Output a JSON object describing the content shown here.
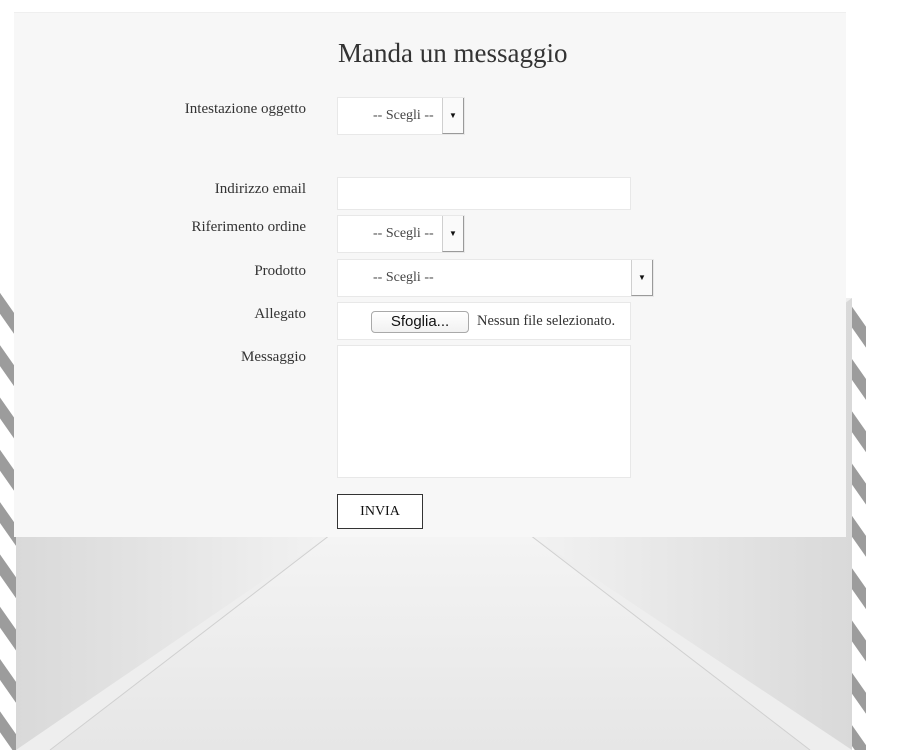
{
  "form": {
    "title": "Manda un messaggio",
    "subject": {
      "label": "Intestazione oggetto",
      "value": "-- Scegli --"
    },
    "email": {
      "label": "Indirizzo email",
      "value": ""
    },
    "order_ref": {
      "label": "Riferimento ordine",
      "value": "-- Scegli --"
    },
    "product": {
      "label": "Prodotto",
      "value": "-- Scegli --"
    },
    "attachment": {
      "label": "Allegato",
      "button_label": "Sfoglia...",
      "status": "Nessun file selezionato."
    },
    "message": {
      "label": "Messaggio",
      "value": ""
    },
    "submit_label": "INVIA"
  },
  "icons": {
    "dropdown": "caret-down-icon"
  }
}
